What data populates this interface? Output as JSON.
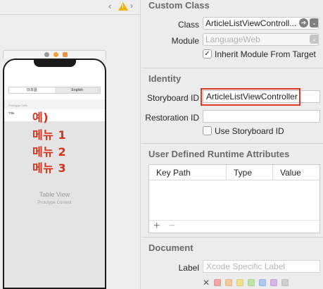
{
  "toolbar": {
    "back_glyph": "‹",
    "forward_glyph": "›",
    "warning_mark": "!",
    "chevron_glyph": "›",
    "warning_color": "#f0b400"
  },
  "canvas": {
    "segment_items": [
      "日本語",
      "English"
    ],
    "prototype_cells_label": "Prototype Cells",
    "cell_title": "Title",
    "annotation_lines": [
      "예)",
      "메뉴 1",
      "메뉴 2",
      "메뉴 3"
    ],
    "annotation_color": "#d6311c",
    "table_view_title": "Table View",
    "table_view_subtitle": "Prototype Content"
  },
  "inspector": {
    "custom_class": {
      "title": "Custom Class",
      "class_label": "Class",
      "class_value": "ArticleListViewControll...",
      "module_label": "Module",
      "module_placeholder": "LanguageWeb",
      "inherit_label": "Inherit Module From Target",
      "inherit_checked": true,
      "arrow_glyph": "➔",
      "dropdown_glyph": "⌄"
    },
    "identity": {
      "title": "Identity",
      "storyboard_id_label": "Storyboard ID",
      "storyboard_id_value": "ArticleListViewController",
      "restoration_id_label": "Restoration ID",
      "restoration_id_value": "",
      "use_storyboard_id_label": "Use Storyboard ID",
      "use_storyboard_id_checked": false,
      "highlight_color": "#e03a28"
    },
    "runtime_attributes": {
      "title": "User Defined Runtime Attributes",
      "columns": [
        "Key Path",
        "Type",
        "Value"
      ],
      "add_glyph": "+",
      "remove_glyph": "−"
    },
    "document": {
      "title": "Document",
      "label_label": "Label",
      "label_placeholder": "Xcode Specific Label",
      "clear_glyph": "✕",
      "swatch_colors": [
        "#f3a6a6",
        "#f6c79a",
        "#f3e08e",
        "#bfe3a0",
        "#a8c8f2",
        "#d2b3ea",
        "#cfcfcf"
      ]
    }
  }
}
